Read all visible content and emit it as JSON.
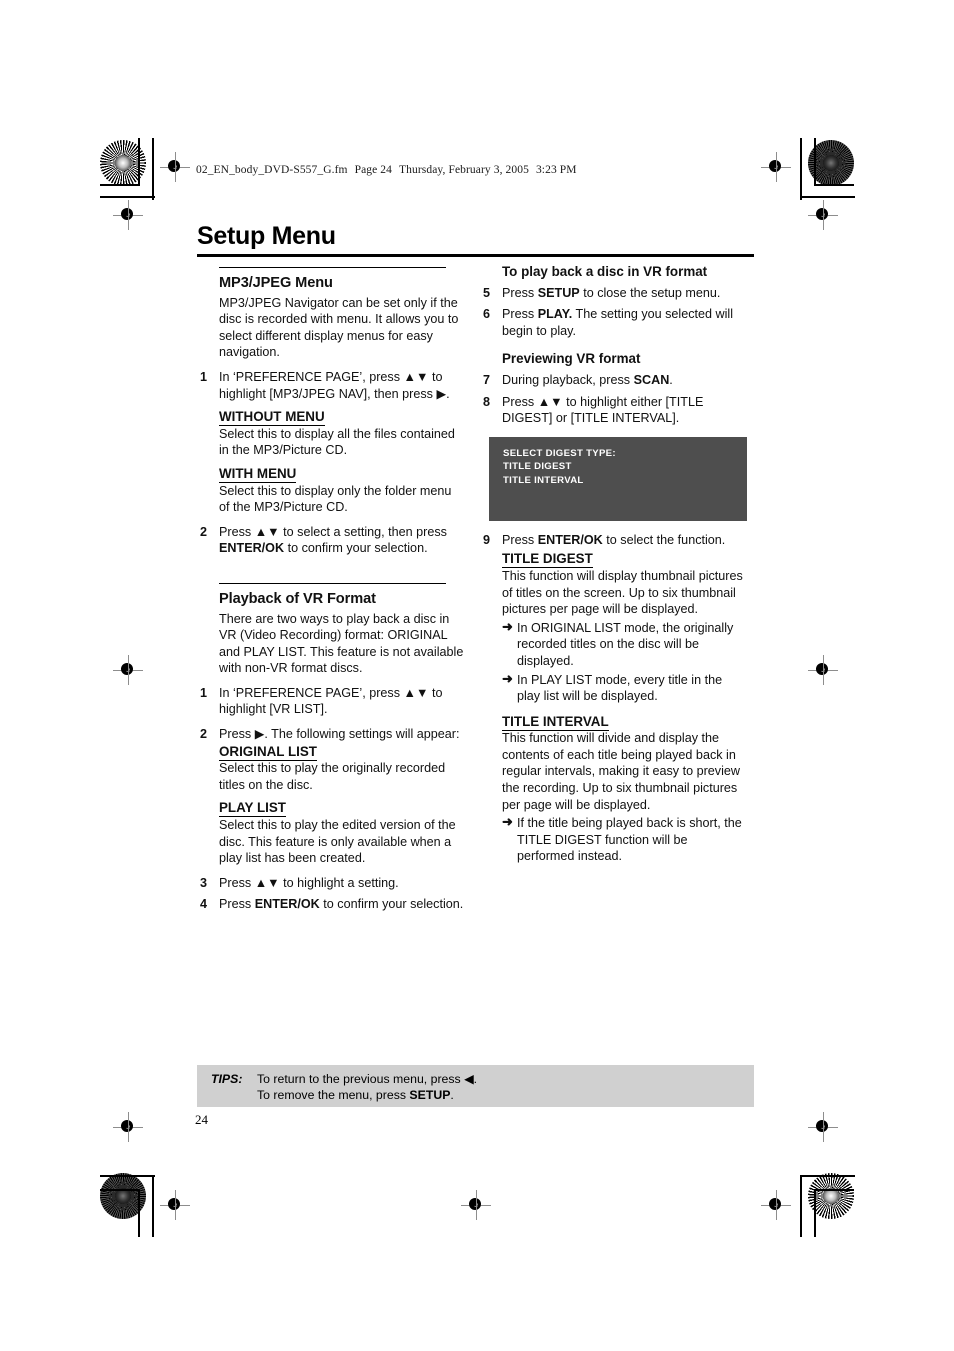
{
  "header": {
    "filename": "02_EN_body_DVD-S557_G.fm",
    "page_label": "Page 24",
    "date": "Thursday, February 3, 2005",
    "time": "3:23 PM"
  },
  "page_title": "Setup Menu",
  "page_number": "24",
  "colors": {
    "osd_background": "#4e4e4e",
    "osd_text": "#ffffff",
    "tips_background": "#d0d0d0",
    "rule": "#000000"
  },
  "left_column": {
    "section1": {
      "heading": "MP3/JPEG Menu",
      "intro": "MP3/JPEG Navigator can be set only if the disc is recorded with menu. It allows you to select different display menus for easy navigation.",
      "steps": [
        {
          "num": "1",
          "text_1": "In ‘PREFERENCE PAGE’, press ",
          "arrows": "▲▼",
          "text_2": " to highlight [MP3/JPEG NAV], then press ",
          "play": "▶",
          "text_3": "."
        },
        {
          "num": "2",
          "text_1": "Press ",
          "arrows": "▲▼",
          "text_2": " to select a setting, then press ",
          "bold": "ENTER/OK",
          "text_3": " to confirm your selection."
        }
      ],
      "options": [
        {
          "title": "WITHOUT MENU",
          "desc": "Select this to display all the files contained in the MP3/Picture CD."
        },
        {
          "title": "WITH MENU",
          "desc": "Select this to display only the folder menu of the MP3/Picture CD."
        }
      ]
    },
    "section2": {
      "heading": "Playback of VR Format",
      "intro": "There are two ways to play back a disc in VR (Video Recording) format: ORIGINAL and PLAY LIST. This feature is not available with non-VR format discs.",
      "step1": {
        "num": "1",
        "text_1": "In ‘PREFERENCE PAGE’, press ",
        "arrows": "▲▼",
        "text_2": " to highlight [VR LIST]."
      },
      "step2": {
        "num": "2",
        "text_1": "Press ",
        "play": "▶",
        "text_2": ". The following settings will appear:"
      },
      "options": [
        {
          "title": "ORIGINAL LIST",
          "desc": "Select this to play the originally recorded titles on the disc."
        },
        {
          "title": "PLAY LIST",
          "desc": "Select this to play the edited version of the disc. This feature is only available when a play list has been created."
        }
      ],
      "step3": {
        "num": "3",
        "text_1": "Press ",
        "arrows": "▲▼",
        "text_2": " to highlight a setting."
      },
      "step4": {
        "num": "4",
        "text_1": "Press ",
        "bold": "ENTER/OK",
        "text_2": " to confirm your selection."
      }
    }
  },
  "right_column": {
    "section1": {
      "heading": "To play back a disc in VR format",
      "step5": {
        "num": "5",
        "text_1": "Press ",
        "bold": "SETUP",
        "text_2": " to close the setup menu."
      },
      "step6": {
        "num": "6",
        "text_1": "Press ",
        "bold": "PLAY.",
        "text_2": " The setting you selected will begin to play."
      }
    },
    "section2": {
      "heading": "Previewing VR format",
      "step7": {
        "num": "7",
        "text_1": "During playback, press ",
        "bold": "SCAN",
        "text_2": "."
      },
      "step8": {
        "num": "8",
        "text_1": "Press ",
        "arrows": "▲▼",
        "text_2": " to highlight either [TITLE DIGEST] or [TITLE INTERVAL]."
      },
      "osd_screen": {
        "line1": "SELECT DIGEST TYPE:",
        "line2": "TITLE DIGEST",
        "line3": "TITLE INTERVAL"
      },
      "step9": {
        "num": "9",
        "text_1": "Press ",
        "bold": "ENTER/OK",
        "text_2": " to select the function."
      }
    },
    "title_digest": {
      "title": "TITLE DIGEST",
      "desc": "This function will display thumbnail pictures of titles on the screen. Up to six thumbnail pictures per page will be displayed.",
      "notes": [
        "In ORIGINAL LIST mode, the originally recorded titles on the disc will be displayed.",
        "In PLAY LIST mode, every title in the play list will be displayed."
      ]
    },
    "title_interval": {
      "title": "TITLE INTERVAL",
      "desc": "This function will divide and display the contents of each title being played back in regular intervals, making it easy to preview the recording. Up to six thumbnail pictures per page will be displayed.",
      "notes": [
        "If the title being played back is short, the TITLE DIGEST function will be performed instead."
      ]
    }
  },
  "tips": {
    "label": "TIPS:",
    "line1_a": "To return to the previous menu, press ",
    "line1_arrow": "◀",
    "line1_b": ".",
    "line2_a": "To remove the menu, press ",
    "line2_bold": "SETUP",
    "line2_b": "."
  },
  "icons": {
    "arrow_bullet": "➜",
    "up_down": "▲▼",
    "right_triangle": "▶",
    "left_triangle": "◀"
  }
}
